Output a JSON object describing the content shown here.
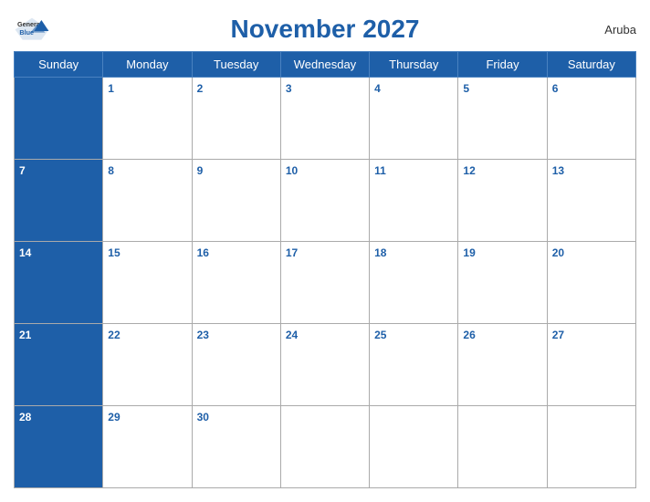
{
  "header": {
    "title": "November 2027",
    "country": "Aruba",
    "logo_general": "General",
    "logo_blue": "Blue"
  },
  "days_of_week": [
    "Sunday",
    "Monday",
    "Tuesday",
    "Wednesday",
    "Thursday",
    "Friday",
    "Saturday"
  ],
  "weeks": [
    [
      null,
      1,
      2,
      3,
      4,
      5,
      6
    ],
    [
      7,
      8,
      9,
      10,
      11,
      12,
      13
    ],
    [
      14,
      15,
      16,
      17,
      18,
      19,
      20
    ],
    [
      21,
      22,
      23,
      24,
      25,
      26,
      27
    ],
    [
      28,
      29,
      30,
      null,
      null,
      null,
      null
    ]
  ]
}
